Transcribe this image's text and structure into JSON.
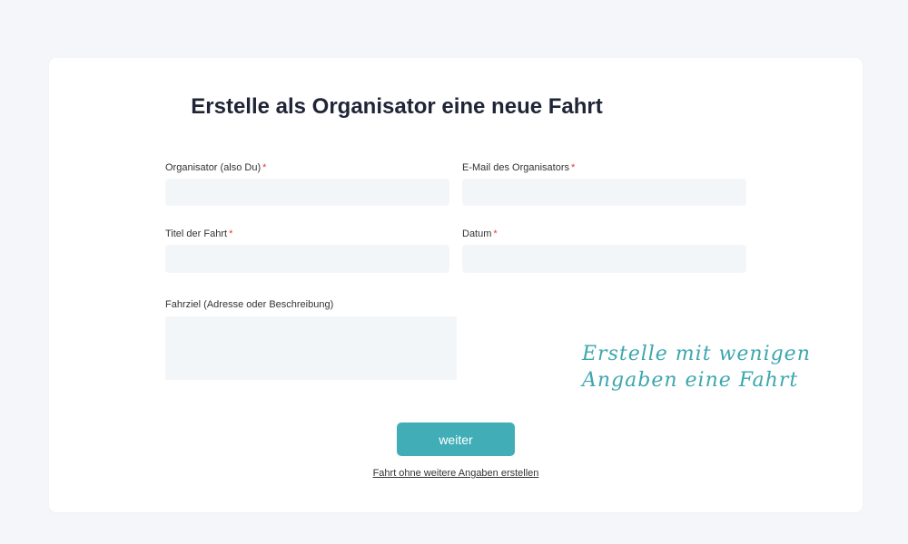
{
  "form": {
    "title": "Erstelle als Organisator eine neue Fahrt",
    "required_marker": "*",
    "organizer": {
      "label": "Organisator (also Du)",
      "value": ""
    },
    "email": {
      "label": "E-Mail des Organisators",
      "value": ""
    },
    "trip_title": {
      "label": "Titel der Fahrt",
      "value": ""
    },
    "date": {
      "label": "Datum",
      "value": ""
    },
    "destination": {
      "label": "Fahrziel (Adresse oder Beschreibung)",
      "value": ""
    },
    "submit_label": "weiter",
    "skip_link": "Fahrt ohne weitere Angaben erstellen"
  },
  "hint": {
    "line1": "Erstelle mit wenigen",
    "line2": "Angaben eine Fahrt"
  },
  "colors": {
    "accent": "#41aeb7",
    "hint_text": "#3da7af",
    "required": "#e23b3b",
    "input_bg": "#f3f6f9",
    "page_bg": "#f4f6f9"
  }
}
